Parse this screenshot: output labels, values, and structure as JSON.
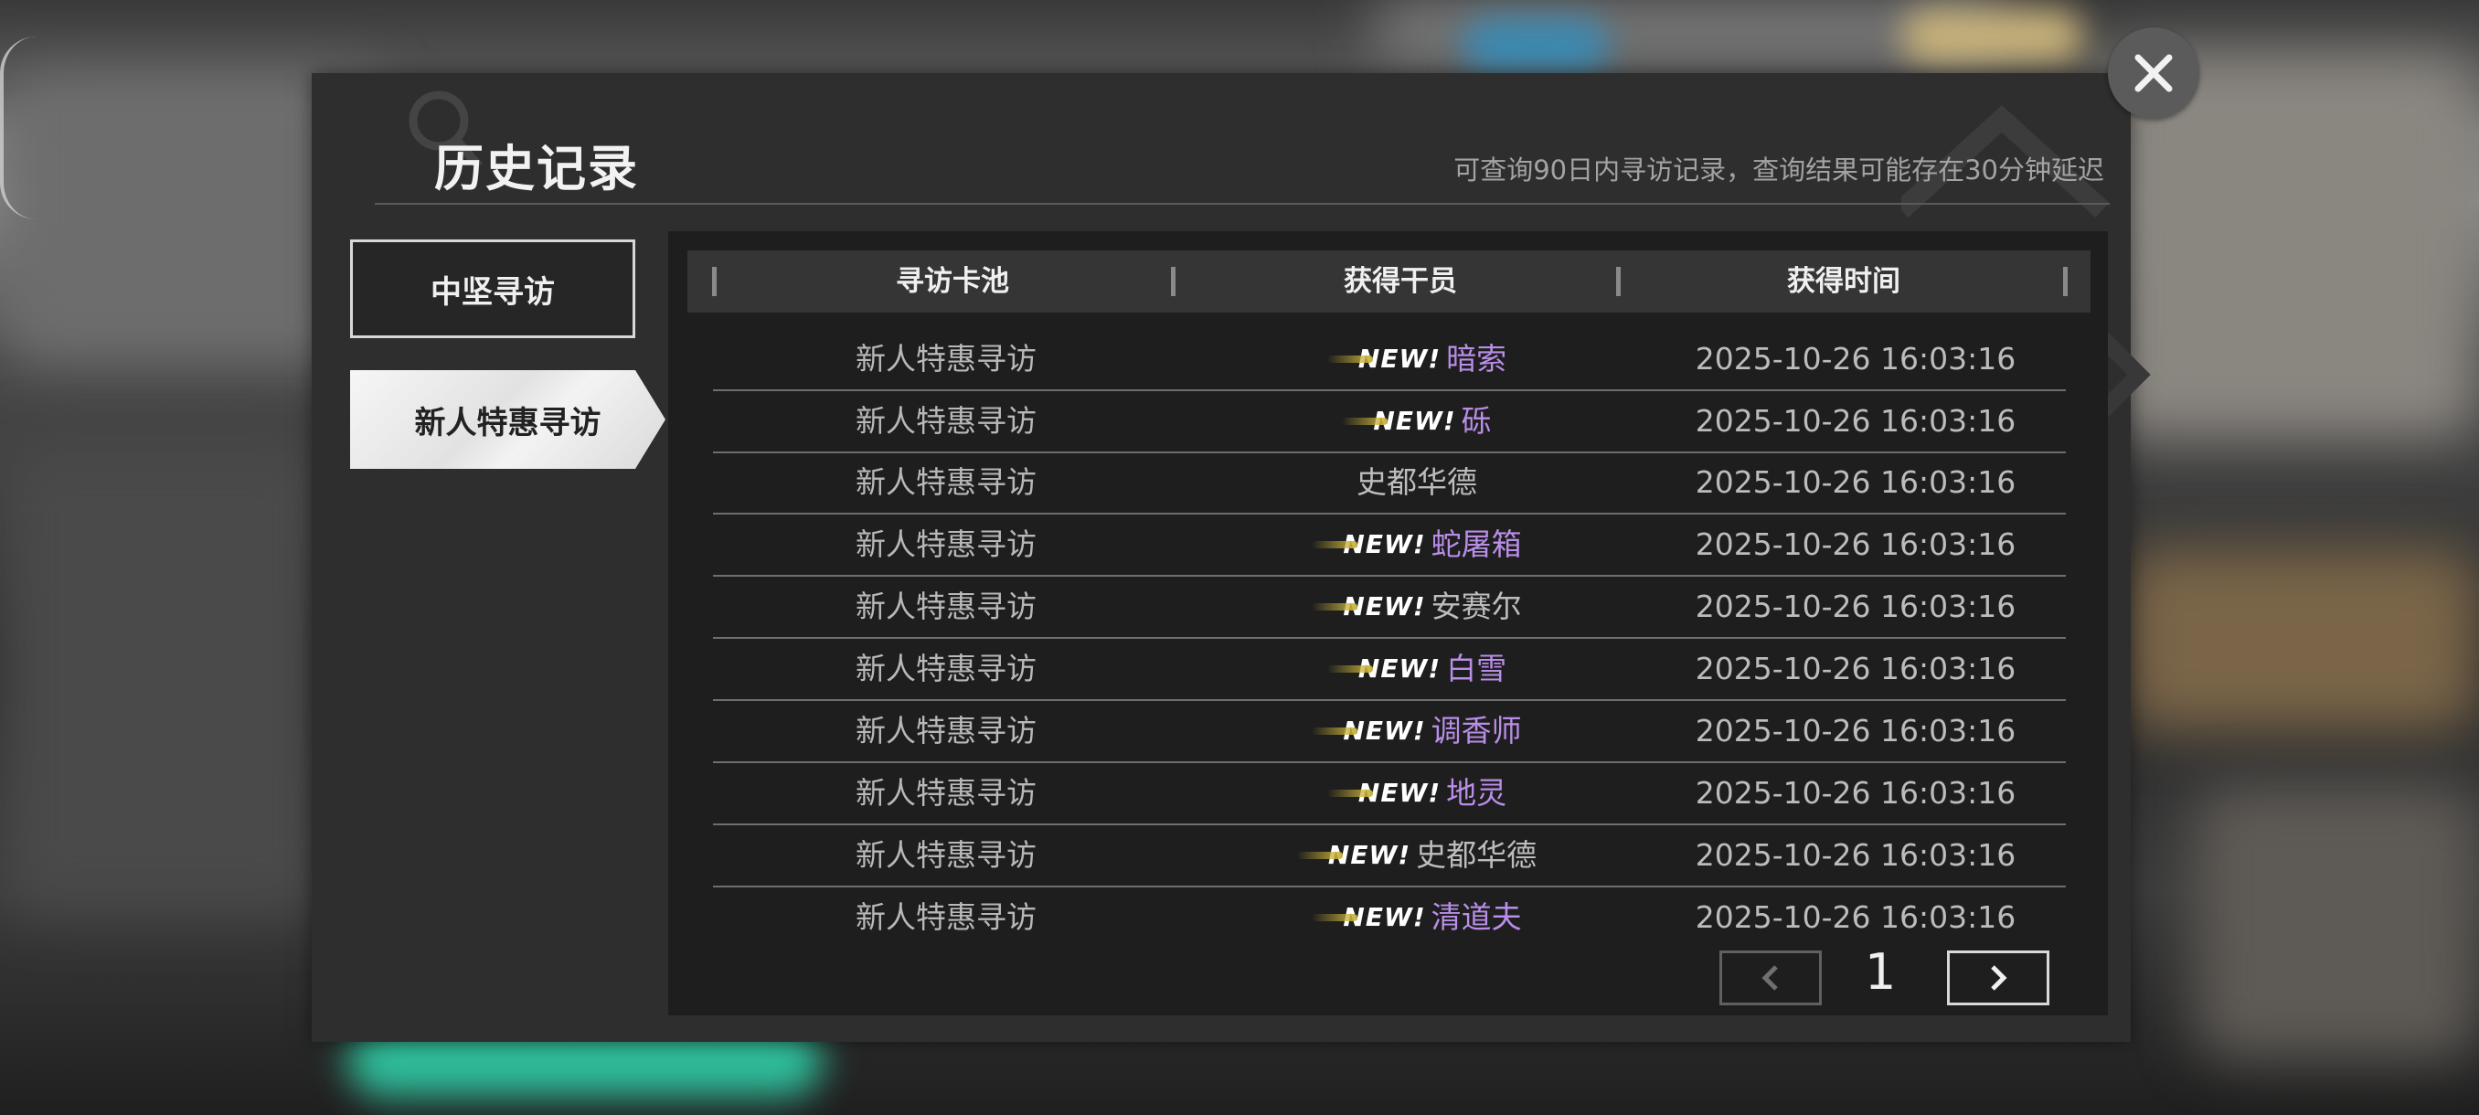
{
  "dialog": {
    "title": "历史记录",
    "hint": "可查询90日内寻访记录，查询结果可能存在30分钟延迟"
  },
  "tabs": [
    {
      "label": "中坚寻访"
    },
    {
      "label": "新人特惠寻访"
    }
  ],
  "table": {
    "headers": [
      "寻访卡池",
      "获得干员",
      "获得时间"
    ],
    "rows": [
      {
        "pool": "新人特惠寻访",
        "new": "NEW!",
        "operator": "暗索",
        "time": "2025-10-26 16:03:16"
      },
      {
        "pool": "新人特惠寻访",
        "new": "NEW!",
        "operator": "砾",
        "time": "2025-10-26 16:03:16"
      },
      {
        "pool": "新人特惠寻访",
        "new": "",
        "operator": "史都华德",
        "time": "2025-10-26 16:03:16"
      },
      {
        "pool": "新人特惠寻访",
        "new": "NEW!",
        "operator": "蛇屠箱",
        "time": "2025-10-26 16:03:16"
      },
      {
        "pool": "新人特惠寻访",
        "new": "NEW!",
        "operator": "安赛尔",
        "time": "2025-10-26 16:03:16"
      },
      {
        "pool": "新人特惠寻访",
        "new": "NEW!",
        "operator": "白雪",
        "time": "2025-10-26 16:03:16"
      },
      {
        "pool": "新人特惠寻访",
        "new": "NEW!",
        "operator": "调香师",
        "time": "2025-10-26 16:03:16"
      },
      {
        "pool": "新人特惠寻访",
        "new": "NEW!",
        "operator": "地灵",
        "time": "2025-10-26 16:03:16"
      },
      {
        "pool": "新人特惠寻访",
        "new": "NEW!",
        "operator": "史都华德",
        "time": "2025-10-26 16:03:16"
      },
      {
        "pool": "新人特惠寻访",
        "new": "NEW!",
        "operator": "清道夫",
        "time": "2025-10-26 16:03:16"
      }
    ]
  },
  "pagination": {
    "page": "1"
  },
  "colors": {
    "rare_operator": "#b98ee8",
    "common_operator": "#bdbdbd",
    "accent_new_streak": "#c9b23a"
  }
}
